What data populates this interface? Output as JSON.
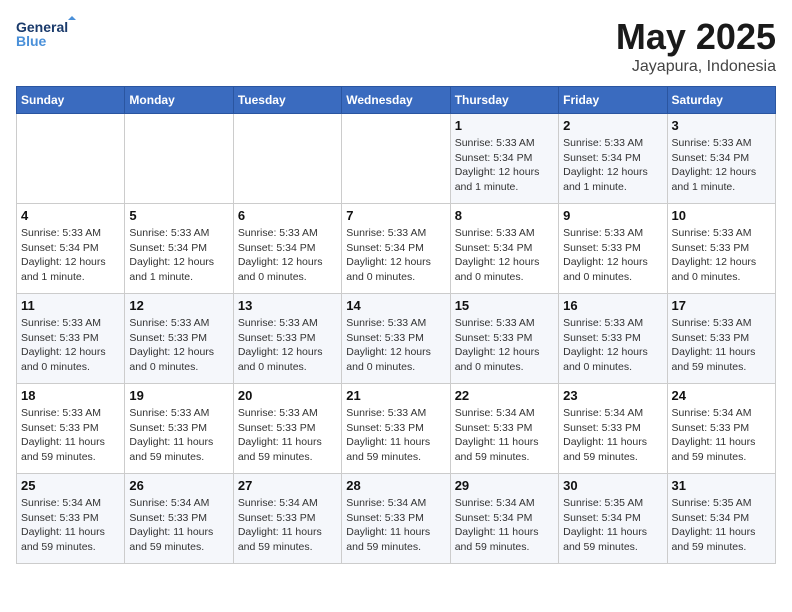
{
  "header": {
    "logo_line1": "General",
    "logo_line2": "Blue",
    "month": "May 2025",
    "location": "Jayapura, Indonesia"
  },
  "days_of_week": [
    "Sunday",
    "Monday",
    "Tuesday",
    "Wednesday",
    "Thursday",
    "Friday",
    "Saturday"
  ],
  "weeks": [
    [
      {
        "day": "",
        "info": ""
      },
      {
        "day": "",
        "info": ""
      },
      {
        "day": "",
        "info": ""
      },
      {
        "day": "",
        "info": ""
      },
      {
        "day": "1",
        "info": "Sunrise: 5:33 AM\nSunset: 5:34 PM\nDaylight: 12 hours\nand 1 minute."
      },
      {
        "day": "2",
        "info": "Sunrise: 5:33 AM\nSunset: 5:34 PM\nDaylight: 12 hours\nand 1 minute."
      },
      {
        "day": "3",
        "info": "Sunrise: 5:33 AM\nSunset: 5:34 PM\nDaylight: 12 hours\nand 1 minute."
      }
    ],
    [
      {
        "day": "4",
        "info": "Sunrise: 5:33 AM\nSunset: 5:34 PM\nDaylight: 12 hours\nand 1 minute."
      },
      {
        "day": "5",
        "info": "Sunrise: 5:33 AM\nSunset: 5:34 PM\nDaylight: 12 hours\nand 1 minute."
      },
      {
        "day": "6",
        "info": "Sunrise: 5:33 AM\nSunset: 5:34 PM\nDaylight: 12 hours\nand 0 minutes."
      },
      {
        "day": "7",
        "info": "Sunrise: 5:33 AM\nSunset: 5:34 PM\nDaylight: 12 hours\nand 0 minutes."
      },
      {
        "day": "8",
        "info": "Sunrise: 5:33 AM\nSunset: 5:34 PM\nDaylight: 12 hours\nand 0 minutes."
      },
      {
        "day": "9",
        "info": "Sunrise: 5:33 AM\nSunset: 5:33 PM\nDaylight: 12 hours\nand 0 minutes."
      },
      {
        "day": "10",
        "info": "Sunrise: 5:33 AM\nSunset: 5:33 PM\nDaylight: 12 hours\nand 0 minutes."
      }
    ],
    [
      {
        "day": "11",
        "info": "Sunrise: 5:33 AM\nSunset: 5:33 PM\nDaylight: 12 hours\nand 0 minutes."
      },
      {
        "day": "12",
        "info": "Sunrise: 5:33 AM\nSunset: 5:33 PM\nDaylight: 12 hours\nand 0 minutes."
      },
      {
        "day": "13",
        "info": "Sunrise: 5:33 AM\nSunset: 5:33 PM\nDaylight: 12 hours\nand 0 minutes."
      },
      {
        "day": "14",
        "info": "Sunrise: 5:33 AM\nSunset: 5:33 PM\nDaylight: 12 hours\nand 0 minutes."
      },
      {
        "day": "15",
        "info": "Sunrise: 5:33 AM\nSunset: 5:33 PM\nDaylight: 12 hours\nand 0 minutes."
      },
      {
        "day": "16",
        "info": "Sunrise: 5:33 AM\nSunset: 5:33 PM\nDaylight: 12 hours\nand 0 minutes."
      },
      {
        "day": "17",
        "info": "Sunrise: 5:33 AM\nSunset: 5:33 PM\nDaylight: 11 hours\nand 59 minutes."
      }
    ],
    [
      {
        "day": "18",
        "info": "Sunrise: 5:33 AM\nSunset: 5:33 PM\nDaylight: 11 hours\nand 59 minutes."
      },
      {
        "day": "19",
        "info": "Sunrise: 5:33 AM\nSunset: 5:33 PM\nDaylight: 11 hours\nand 59 minutes."
      },
      {
        "day": "20",
        "info": "Sunrise: 5:33 AM\nSunset: 5:33 PM\nDaylight: 11 hours\nand 59 minutes."
      },
      {
        "day": "21",
        "info": "Sunrise: 5:33 AM\nSunset: 5:33 PM\nDaylight: 11 hours\nand 59 minutes."
      },
      {
        "day": "22",
        "info": "Sunrise: 5:34 AM\nSunset: 5:33 PM\nDaylight: 11 hours\nand 59 minutes."
      },
      {
        "day": "23",
        "info": "Sunrise: 5:34 AM\nSunset: 5:33 PM\nDaylight: 11 hours\nand 59 minutes."
      },
      {
        "day": "24",
        "info": "Sunrise: 5:34 AM\nSunset: 5:33 PM\nDaylight: 11 hours\nand 59 minutes."
      }
    ],
    [
      {
        "day": "25",
        "info": "Sunrise: 5:34 AM\nSunset: 5:33 PM\nDaylight: 11 hours\nand 59 minutes."
      },
      {
        "day": "26",
        "info": "Sunrise: 5:34 AM\nSunset: 5:33 PM\nDaylight: 11 hours\nand 59 minutes."
      },
      {
        "day": "27",
        "info": "Sunrise: 5:34 AM\nSunset: 5:33 PM\nDaylight: 11 hours\nand 59 minutes."
      },
      {
        "day": "28",
        "info": "Sunrise: 5:34 AM\nSunset: 5:33 PM\nDaylight: 11 hours\nand 59 minutes."
      },
      {
        "day": "29",
        "info": "Sunrise: 5:34 AM\nSunset: 5:34 PM\nDaylight: 11 hours\nand 59 minutes."
      },
      {
        "day": "30",
        "info": "Sunrise: 5:35 AM\nSunset: 5:34 PM\nDaylight: 11 hours\nand 59 minutes."
      },
      {
        "day": "31",
        "info": "Sunrise: 5:35 AM\nSunset: 5:34 PM\nDaylight: 11 hours\nand 59 minutes."
      }
    ]
  ]
}
